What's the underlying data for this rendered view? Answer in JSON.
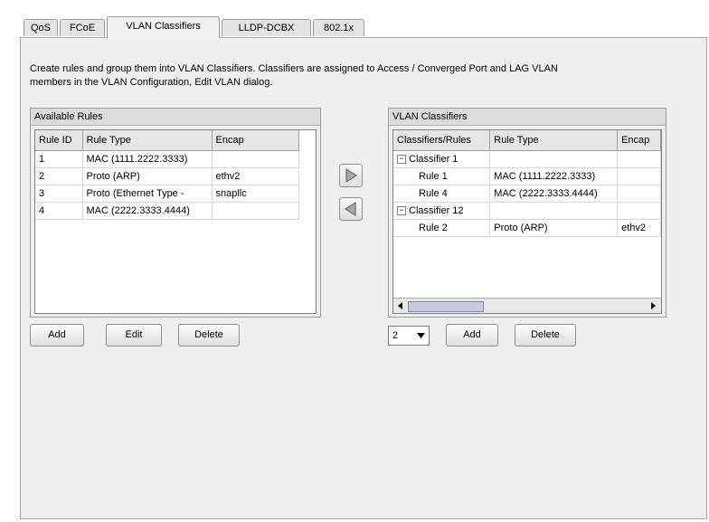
{
  "tabs": [
    {
      "label": "QoS",
      "active": false
    },
    {
      "label": "FCoE",
      "active": false
    },
    {
      "label": "VLAN Classifiers",
      "active": true
    },
    {
      "label": "LLDP-DCBX",
      "active": false
    },
    {
      "label": "802.1x",
      "active": false
    }
  ],
  "description": {
    "line1": "Create rules and group them into VLAN Classifiers.  Classifiers are assigned to Access / Converged Port and LAG VLAN",
    "line2": "members in the VLAN Configuration, Edit VLAN dialog."
  },
  "available_rules": {
    "title": "Available Rules",
    "columns": [
      "Rule ID",
      "Rule Type",
      "Encap"
    ],
    "rows": [
      [
        "1",
        "MAC (1111.2222.3333)",
        ""
      ],
      [
        "2",
        "Proto (ARP)",
        "ethv2"
      ],
      [
        "3",
        "Proto (Ethernet Type -",
        "snapllc"
      ],
      [
        "4",
        "MAC (2222.3333.4444)",
        ""
      ]
    ],
    "buttons": {
      "add": "Add",
      "edit": "Edit",
      "delete": "Delete"
    }
  },
  "move_buttons": {
    "right_icon": "arrow-right-icon",
    "left_icon": "arrow-left-icon"
  },
  "vlan_classifiers": {
    "title": "VLAN Classifiers",
    "columns": [
      "Classifiers/Rules",
      "Rule Type",
      "Encap"
    ],
    "rows": [
      [
        "Classifier 1",
        "",
        ""
      ],
      [
        "Rule 1",
        "MAC (1111.2222.3333)",
        ""
      ],
      [
        "Rule 4",
        "MAC (2222.3333.4444)",
        ""
      ],
      [
        "Classifier 12",
        "",
        ""
      ],
      [
        "Rule 2",
        "Proto (ARP)",
        "ethv2"
      ]
    ],
    "select_value": "2",
    "buttons": {
      "add": "Add",
      "delete": "Delete"
    }
  }
}
